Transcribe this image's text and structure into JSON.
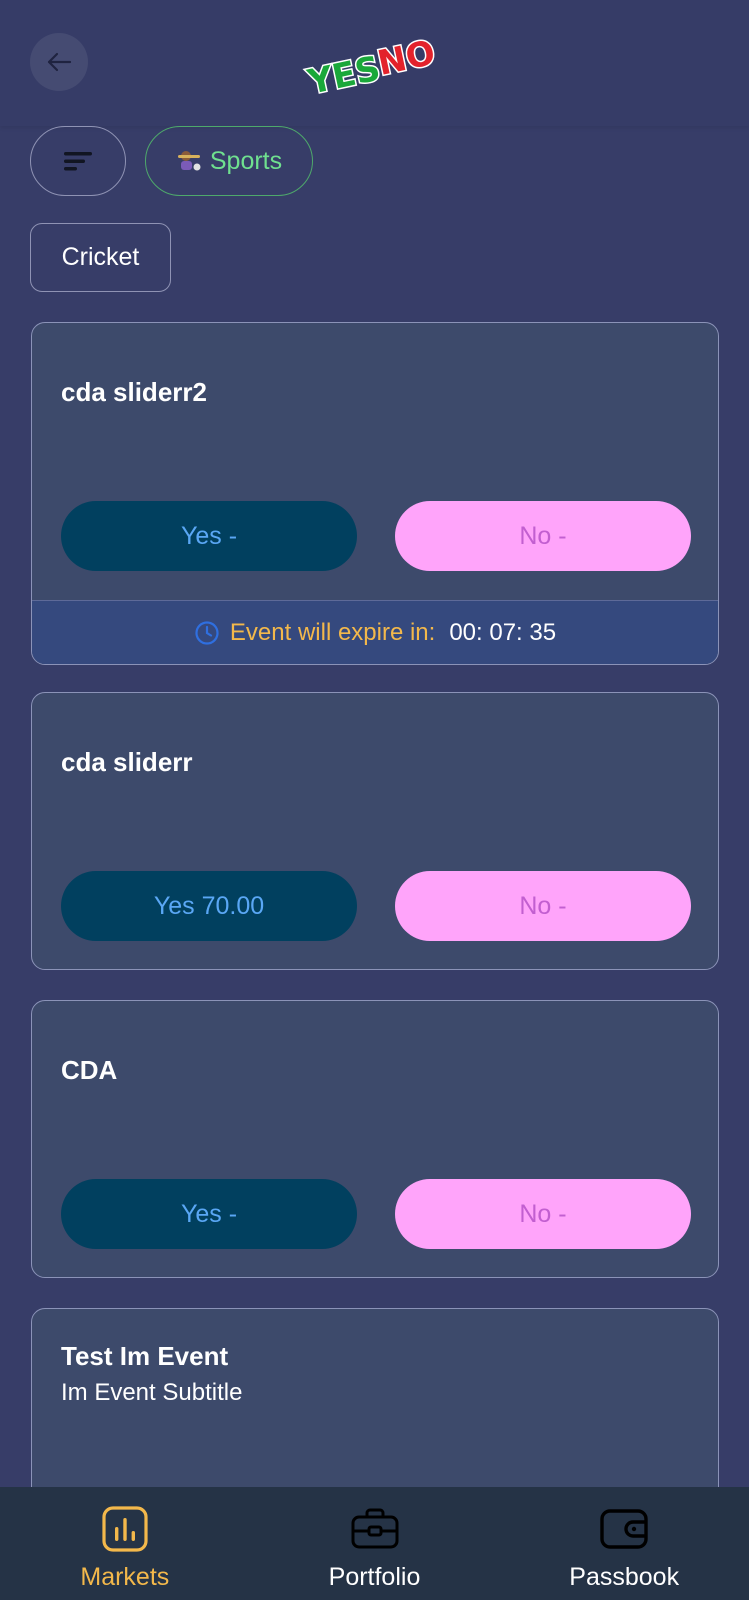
{
  "header": {
    "logo_text_yes": "YES",
    "logo_text_no": "NO"
  },
  "filters": {
    "category_label": "Sports",
    "category_icon": "sports-emoji-icon",
    "subcategory_label": "Cricket"
  },
  "events": [
    {
      "title": "cda sliderr2",
      "subtitle": "",
      "yes_label": "Yes -",
      "no_label": "No -",
      "expire_label": "Event will expire in:",
      "expire_time": "00: 07: 35"
    },
    {
      "title": "cda sliderr",
      "subtitle": "",
      "yes_label": "Yes 70.00",
      "no_label": "No -"
    },
    {
      "title": "CDA",
      "subtitle": "",
      "yes_label": "Yes -",
      "no_label": "No -"
    },
    {
      "title": "Test Im Event",
      "subtitle": "Im Event Subtitle"
    }
  ],
  "bottom_nav": {
    "items": [
      {
        "label": "Markets",
        "icon": "bar-chart-icon",
        "active": true
      },
      {
        "label": "Portfolio",
        "icon": "briefcase-icon",
        "active": false
      },
      {
        "label": "Passbook",
        "icon": "wallet-icon",
        "active": false
      }
    ]
  },
  "colors": {
    "background": "#373d68",
    "card": "#3d4a6b",
    "yes_pill": "#01405f",
    "yes_text": "#5aa7f5",
    "no_pill": "#ffa4fa",
    "no_text": "#c25fd0",
    "accent": "#f3b84b",
    "nav_bg": "#253346"
  }
}
